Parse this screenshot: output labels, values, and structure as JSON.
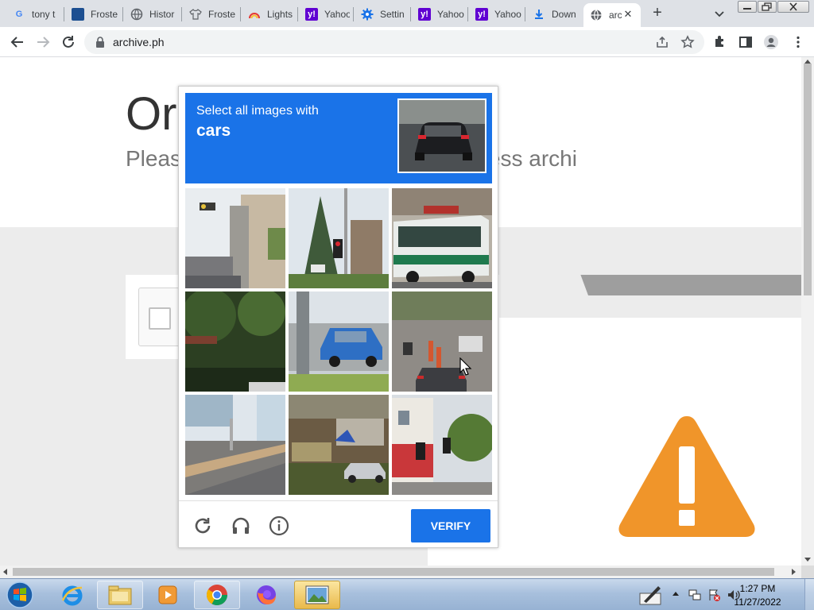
{
  "tabs": [
    {
      "title": "tony t",
      "icon": "google-icon"
    },
    {
      "title": "Froste",
      "icon": "book-icon"
    },
    {
      "title": "Histor",
      "icon": "globe-icon"
    },
    {
      "title": "Froste",
      "icon": "shirt-icon"
    },
    {
      "title": "Lights",
      "icon": "rainbow-icon"
    },
    {
      "title": "Yahoo",
      "icon": "yahoo-icon"
    },
    {
      "title": "Settin",
      "icon": "gear-icon"
    },
    {
      "title": "Yahoo",
      "icon": "yahoo-icon"
    },
    {
      "title": "Yahoo",
      "icon": "yahoo-icon"
    },
    {
      "title": "Down",
      "icon": "download-icon"
    },
    {
      "title": "arc",
      "icon": "globe-icon",
      "active": true
    }
  ],
  "address_bar": {
    "url": "archive.ph"
  },
  "page": {
    "heading": "Or",
    "subtext": "Pleas                                      t to access archi"
  },
  "captcha": {
    "instruction": "Select all images with",
    "target": "cars",
    "verify_label": "VERIFY"
  },
  "clock": {
    "time": "1:27 PM",
    "date": "11/27/2022"
  },
  "colors": {
    "captcha_blue": "#1a73e8",
    "warning_orange": "#f0952a",
    "page_gray": "#ececec"
  }
}
